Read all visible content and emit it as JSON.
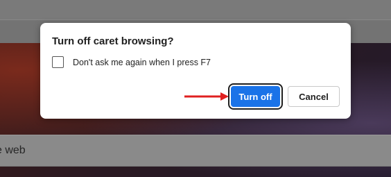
{
  "dialog": {
    "title": "Turn off caret browsing?",
    "checkbox_label": "Don't ask me again when I press F7",
    "checkbox_checked": false,
    "primary_button": "Turn off",
    "secondary_button": "Cancel"
  },
  "background": {
    "search_text": "e web"
  },
  "colors": {
    "accent": "#1a73e8",
    "arrow": "#e02020"
  }
}
